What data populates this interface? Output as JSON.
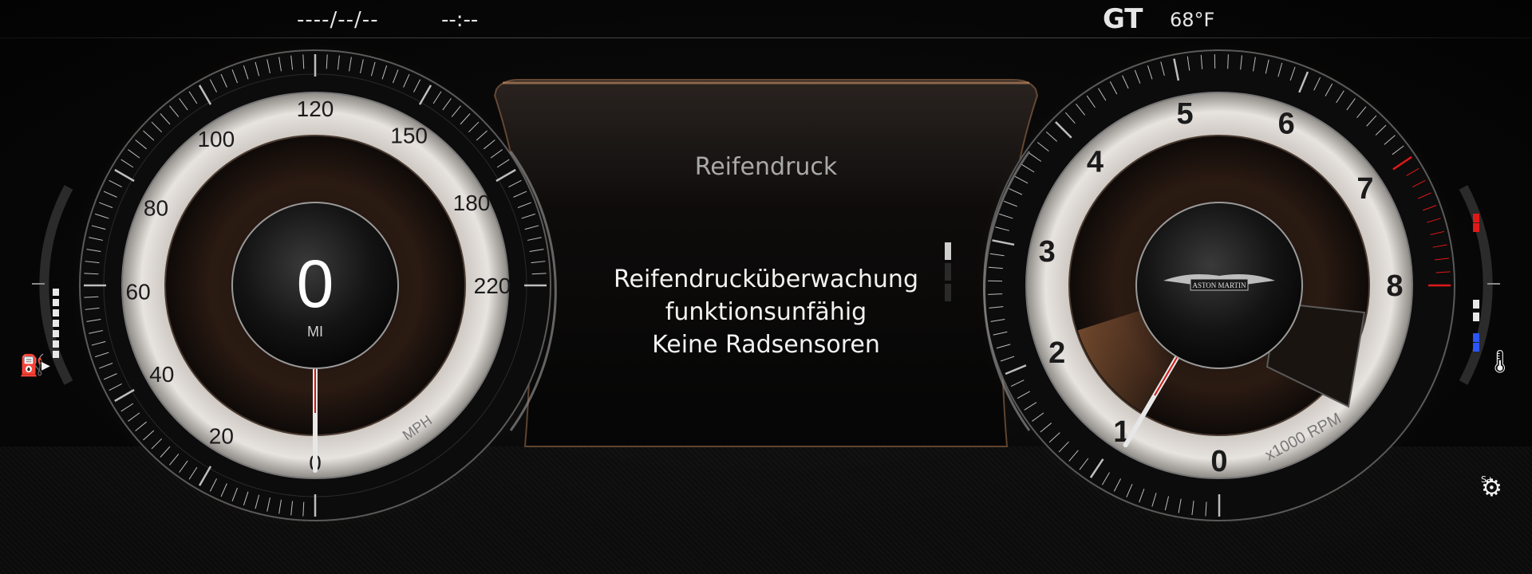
{
  "header": {
    "date": "----/--/--",
    "time": "--:--",
    "drive_mode": "GT",
    "outside_temp": "68°F"
  },
  "speedometer": {
    "value": "0",
    "unit_label": "MI",
    "scale_label": "MPH",
    "tick_labels": [
      "0",
      "20",
      "40",
      "60",
      "80",
      "100",
      "120",
      "150",
      "180",
      "220"
    ],
    "needle_value_mph": 0
  },
  "message_panel": {
    "title": "Reifendruck",
    "lines": [
      "Reifendrucküberwachung",
      "funktionsunfähig",
      "Keine Radsensoren"
    ]
  },
  "tachometer": {
    "tick_labels": [
      "0",
      "1",
      "2",
      "3",
      "4",
      "5",
      "6",
      "7",
      "8"
    ],
    "scale_label": "x1000 RPM",
    "logo_text": "ASTON MARTIN",
    "redline_start": 7,
    "needle_value_krpm": 0.9
  },
  "fuel_gauge": {
    "icon": "fuel-pump-icon",
    "level_fraction": 0.55
  },
  "coolant_gauge": {
    "icon": "coolant-temp-icon",
    "level_fraction": 0.5
  },
  "drive_icon": {
    "icon": "suspension-sport-plus-icon",
    "label": "S+"
  },
  "colors": {
    "accent": "#b86a3a",
    "redline": "#e01818",
    "cold": "#2a55ff"
  }
}
